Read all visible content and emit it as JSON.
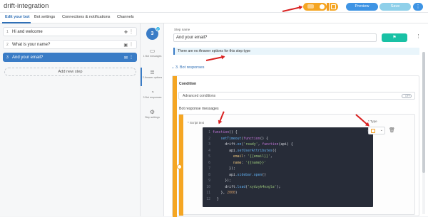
{
  "app": {
    "title": "drift-integration"
  },
  "tabs": [
    {
      "label": "Edit your bot"
    },
    {
      "label": "Bot settings"
    },
    {
      "label": "Connections & notifications"
    },
    {
      "label": "Channels"
    }
  ],
  "toolbar": {
    "preview_label": "Preview",
    "save_label": "Save",
    "more_label": "⋮"
  },
  "steps": [
    {
      "num": "1",
      "label": "Hi and welcome"
    },
    {
      "num": "2",
      "label": "What is your name?"
    },
    {
      "num": "3",
      "label": "And your email?"
    }
  ],
  "add_step_label": "Add new step",
  "nav": {
    "step_number": "3",
    "items": [
      {
        "label": "1 Bot messages"
      },
      {
        "label": "2 Answer options"
      },
      {
        "label": "3 Bot responses"
      },
      {
        "label": "Step settings"
      }
    ]
  },
  "editor": {
    "step_name_label": "Step name",
    "step_name_value": "And your email?",
    "no_options_note": "There are no Answer options for this step type",
    "section_header": "3. Bot responses",
    "condition_title": "Condition",
    "advanced_conditions_label": "Advanced conditions",
    "toggle_label": "OFF",
    "responses_title": "Bot response messages",
    "script_label": "* Script text",
    "type_label": "* Type"
  },
  "code_lines": [
    {
      "n": "1",
      "segments": [
        {
          "t": "function",
          "c": "#c678dd"
        },
        {
          "t": "() {",
          "c": "#d7dae0"
        }
      ]
    },
    {
      "n": "2",
      "segments": [
        {
          "t": "    setTimeout",
          "c": "#61afef"
        },
        {
          "t": "(",
          "c": "#d7dae0"
        },
        {
          "t": "function",
          "c": "#c678dd"
        },
        {
          "t": "() {",
          "c": "#d7dae0"
        }
      ]
    },
    {
      "n": "3",
      "segments": [
        {
          "t": "      drift",
          "c": "#d7dae0"
        },
        {
          "t": ".on",
          "c": "#61afef"
        },
        {
          "t": "(",
          "c": "#d7dae0"
        },
        {
          "t": "'ready'",
          "c": "#98c379"
        },
        {
          "t": ", ",
          "c": "#d7dae0"
        },
        {
          "t": "function",
          "c": "#c678dd"
        },
        {
          "t": "(api) {",
          "c": "#d7dae0"
        }
      ]
    },
    {
      "n": "4",
      "segments": [
        {
          "t": "        api",
          "c": "#d7dae0"
        },
        {
          "t": ".setUserAttributes",
          "c": "#61afef"
        },
        {
          "t": "({",
          "c": "#d7dae0"
        }
      ]
    },
    {
      "n": "5",
      "segments": [
        {
          "t": "          email",
          "c": "#e5c07b"
        },
        {
          "t": ": ",
          "c": "#d7dae0"
        },
        {
          "t": "'{{email}}'",
          "c": "#98c379"
        },
        {
          "t": ",",
          "c": "#d7dae0"
        }
      ]
    },
    {
      "n": "6",
      "segments": [
        {
          "t": "          name",
          "c": "#e5c07b"
        },
        {
          "t": ": ",
          "c": "#d7dae0"
        },
        {
          "t": "'{{name}}'",
          "c": "#98c379"
        }
      ]
    },
    {
      "n": "7",
      "segments": [
        {
          "t": "        });",
          "c": "#d7dae0"
        }
      ]
    },
    {
      "n": "8",
      "segments": [
        {
          "t": "        api",
          "c": "#d7dae0"
        },
        {
          "t": ".sidebar.open",
          "c": "#61afef"
        },
        {
          "t": "()",
          "c": "#d7dae0"
        }
      ]
    },
    {
      "n": "9",
      "segments": [
        {
          "t": "      });",
          "c": "#d7dae0"
        }
      ]
    },
    {
      "n": "10",
      "segments": [
        {
          "t": "      drift",
          "c": "#d7dae0"
        },
        {
          "t": ".load",
          "c": "#61afef"
        },
        {
          "t": "(",
          "c": "#d7dae0"
        },
        {
          "t": "'xydzyk4nxgla'",
          "c": "#98c379"
        },
        {
          "t": ");",
          "c": "#d7dae0"
        }
      ]
    },
    {
      "n": "11",
      "segments": [
        {
          "t": "    }, ",
          "c": "#d7dae0"
        },
        {
          "t": "2000",
          "c": "#d19a66"
        },
        {
          "t": ")",
          "c": "#d7dae0"
        }
      ]
    },
    {
      "n": "12",
      "segments": [
        {
          "t": "  }",
          "c": "#d7dae0"
        }
      ]
    }
  ],
  "colors": {
    "accent_blue": "#3a7cc6",
    "orange": "#f5a623",
    "teal": "#19c1a5",
    "annotation_red": "#d92020"
  },
  "icons": {
    "step_1": "move-icon",
    "step_2": "image-icon",
    "step_3": "email-icon",
    "code": "terminal-icon",
    "type": "code-file-icon",
    "trash": "trash-icon"
  }
}
